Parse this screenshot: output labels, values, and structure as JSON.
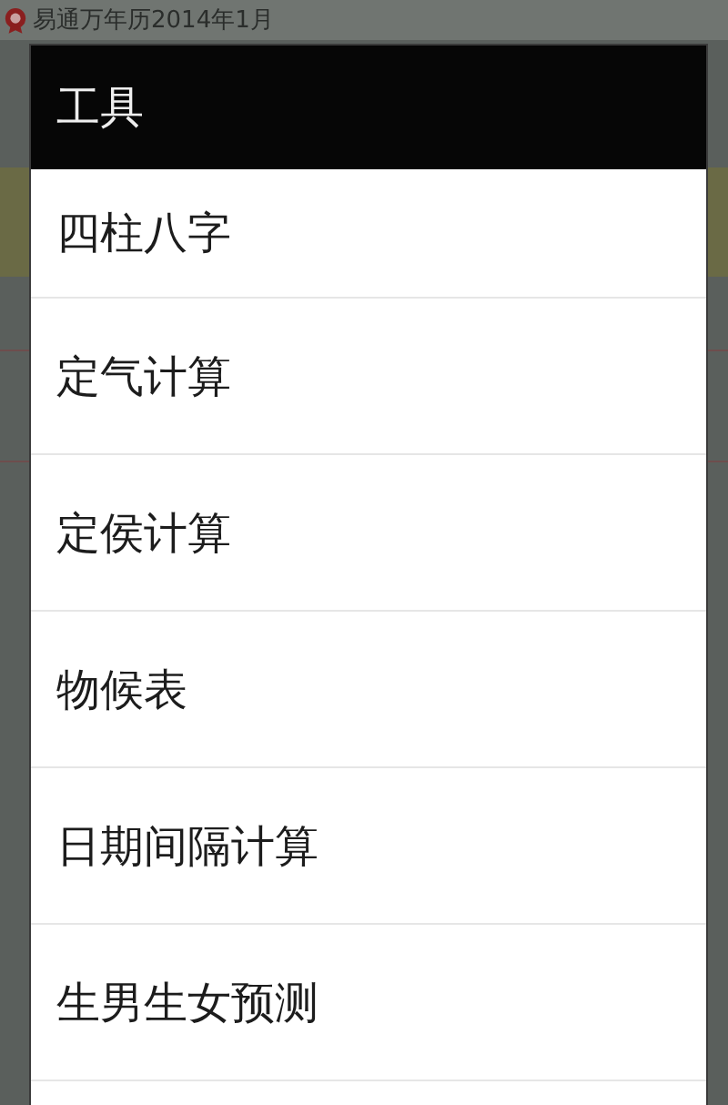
{
  "app_bar": {
    "title": "易通万年历2014年1月"
  },
  "dialog": {
    "title": "工具",
    "items": [
      {
        "label": "四柱八字"
      },
      {
        "label": "定气计算"
      },
      {
        "label": "定侯计算"
      },
      {
        "label": "物候表"
      },
      {
        "label": "日期间隔计算"
      },
      {
        "label": "生男生女预测"
      }
    ]
  }
}
